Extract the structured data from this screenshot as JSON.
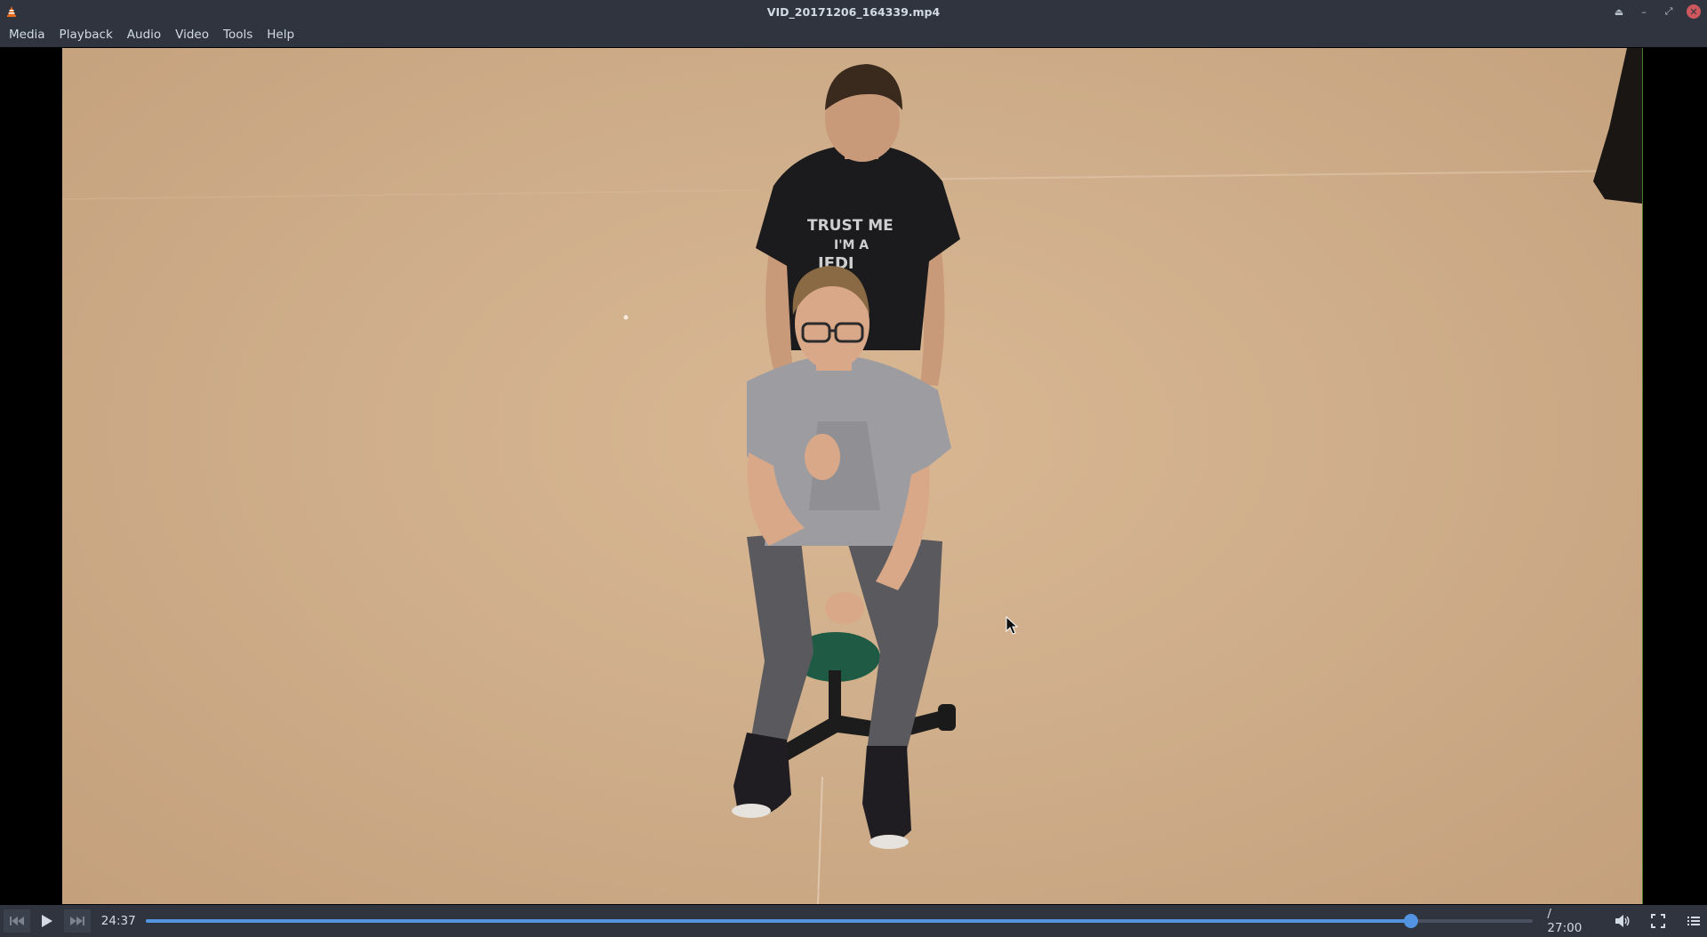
{
  "window": {
    "title": "VID_20171206_164339.mp4",
    "controls": {
      "eject": "⏏",
      "minimize": "–",
      "restore": "⤢",
      "close": "✕"
    }
  },
  "menu": {
    "items": [
      "Media",
      "Playback",
      "Audio",
      "Video",
      "Tools",
      "Help"
    ]
  },
  "video": {
    "shirt_text_line1": "TRUST ME",
    "shirt_text_line2": "I'M A",
    "shirt_text_line3": "JEDI"
  },
  "controls": {
    "elapsed": "24:37",
    "total": "/ 27:00",
    "progress_fraction": 0.912,
    "icons": [
      "previous-icon",
      "play-icon",
      "next-icon",
      "volume-icon",
      "fullscreen-icon",
      "playlist-icon"
    ]
  },
  "colors": {
    "chrome": "#2f343f",
    "accent": "#5294e2",
    "close": "#cc575d"
  }
}
